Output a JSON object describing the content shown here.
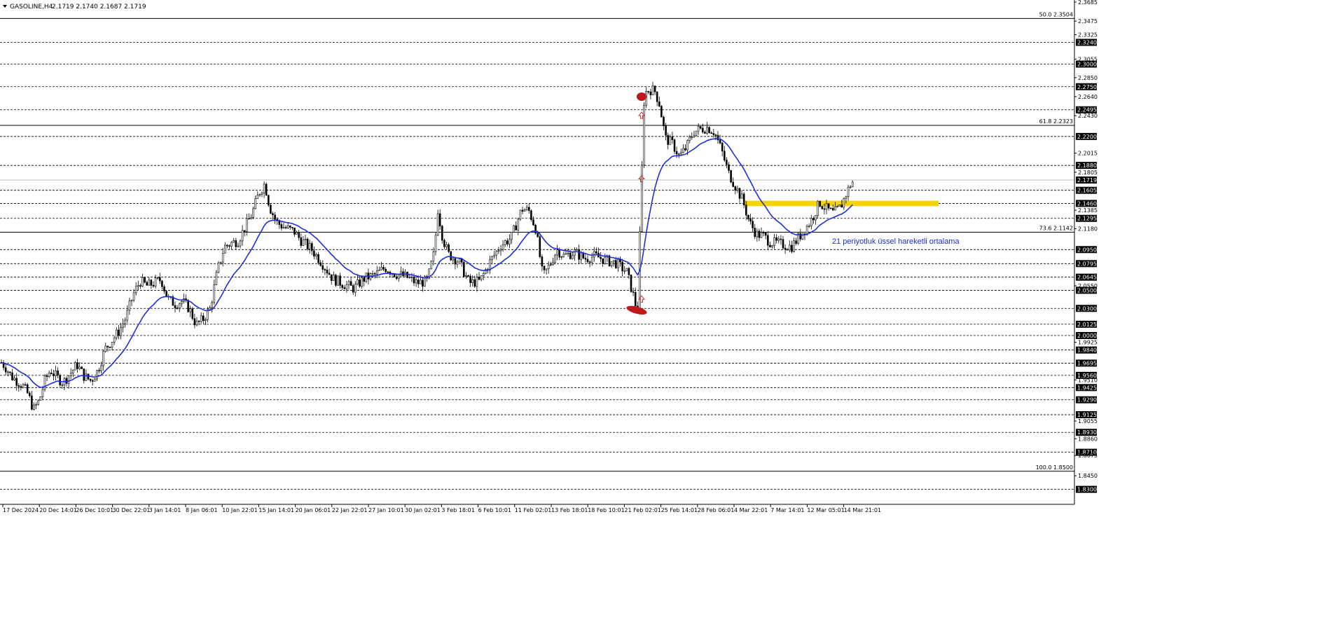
{
  "header": {
    "symbol": "GASOLINE,H4",
    "ohlc": "2.1719 2.1740 2.1687 2.1719"
  },
  "colors": {
    "background": "#ffffff",
    "candle": "#000000",
    "ema": "#1c2fe0",
    "zone": "#f5d400",
    "marker": "#c01818",
    "arrow": "#e03030",
    "grid": "#000000"
  },
  "chart_data": {
    "type": "candlestick",
    "title": "",
    "ylim": [
      1.815,
      2.3685
    ],
    "y_ticks": [
      "2.3685",
      "2.3475",
      "2.3325",
      "2.3240",
      "2.3055",
      "2.3000",
      "2.2850",
      "2.2750",
      "2.2640",
      "2.2495",
      "2.2430",
      "2.2200",
      "2.2015",
      "2.1880",
      "2.1805",
      "2.1719",
      "2.1605",
      "2.1460",
      "2.1385",
      "2.1295",
      "2.1180",
      "2.0950",
      "2.0795",
      "2.0645",
      "2.0550",
      "2.0500",
      "2.0300",
      "2.0125",
      "2.0000",
      "1.9925",
      "1.9840",
      "1.9695",
      "1.9560",
      "1.9510",
      "1.9425",
      "1.9290",
      "1.9125",
      "1.9055",
      "1.8930",
      "1.8860",
      "1.8710",
      "1.8675",
      "1.8450",
      "1.8300"
    ],
    "highlighted_y_ticks": [
      "2.3240",
      "2.3000",
      "2.2750",
      "2.2495",
      "2.2200",
      "2.1880",
      "2.1719",
      "2.1605",
      "2.1460",
      "2.1295",
      "2.0950",
      "2.0795",
      "2.0645",
      "2.0500",
      "2.0300",
      "2.0125",
      "2.0000",
      "1.9840",
      "1.9695",
      "1.9560",
      "1.9425",
      "1.9290",
      "1.9125",
      "1.8930",
      "1.8710",
      "1.8300"
    ],
    "x_ticks": [
      "17 Dec 2024",
      "20 Dec 14:01",
      "26 Dec 10:01",
      "30 Dec 22:01",
      "3 Jan 14:01",
      "8 Jan 06:01",
      "10 Jan 22:01",
      "15 Jan 14:01",
      "20 Jan 06:01",
      "22 Jan 22:01",
      "27 Jan 10:01",
      "30 Jan 02:01",
      "3 Feb 18:01",
      "6 Feb 10:01",
      "11 Feb 02:01",
      "13 Feb 18:01",
      "18 Feb 10:01",
      "21 Feb 02:01",
      "25 Feb 14:01",
      "28 Feb 06:01",
      "4 Mar 22:01",
      "7 Mar 14:01",
      "12 Mar 05:01",
      "14 Mar 21:01"
    ],
    "fib_levels": [
      {
        "label": "50.0 2.3504",
        "value": 2.3504
      },
      {
        "label": "61.8 2.2323",
        "value": 2.2323
      },
      {
        "label": "73.6 2.1142",
        "value": 2.1142
      },
      {
        "label": "100.0 1.8500",
        "value": 1.85
      }
    ],
    "current_price": 2.1719,
    "price_path": [
      [
        0,
        1.972
      ],
      [
        8,
        1.965
      ],
      [
        16,
        1.955
      ],
      [
        24,
        1.95
      ],
      [
        32,
        1.945
      ],
      [
        40,
        1.935
      ],
      [
        48,
        1.918
      ],
      [
        56,
        1.928
      ],
      [
        64,
        1.95
      ],
      [
        72,
        1.962
      ],
      [
        80,
        1.955
      ],
      [
        90,
        1.948
      ],
      [
        100,
        1.958
      ],
      [
        110,
        1.968
      ],
      [
        120,
        1.955
      ],
      [
        130,
        1.95
      ],
      [
        140,
        1.962
      ],
      [
        150,
        1.985
      ],
      [
        160,
        1.995
      ],
      [
        170,
        2.005
      ],
      [
        180,
        2.02
      ],
      [
        190,
        2.045
      ],
      [
        200,
        2.06
      ],
      [
        210,
        2.055
      ],
      [
        220,
        2.058
      ],
      [
        230,
        2.062
      ],
      [
        240,
        2.04
      ],
      [
        250,
        2.035
      ],
      [
        260,
        2.038
      ],
      [
        270,
        2.03
      ],
      [
        280,
        2.012
      ],
      [
        290,
        2.018
      ],
      [
        300,
        2.03
      ],
      [
        310,
        2.07
      ],
      [
        320,
        2.098
      ],
      [
        330,
        2.102
      ],
      [
        340,
        2.105
      ],
      [
        350,
        2.12
      ],
      [
        360,
        2.135
      ],
      [
        370,
        2.158
      ],
      [
        378,
        2.168
      ],
      [
        385,
        2.142
      ],
      [
        395,
        2.125
      ],
      [
        405,
        2.12
      ],
      [
        420,
        2.115
      ],
      [
        430,
        2.105
      ],
      [
        445,
        2.095
      ],
      [
        460,
        2.08
      ],
      [
        475,
        2.063
      ],
      [
        490,
        2.057
      ],
      [
        505,
        2.052
      ],
      [
        520,
        2.063
      ],
      [
        535,
        2.067
      ],
      [
        550,
        2.075
      ],
      [
        565,
        2.068
      ],
      [
        580,
        2.065
      ],
      [
        595,
        2.058
      ],
      [
        610,
        2.06
      ],
      [
        620,
        2.092
      ],
      [
        625,
        2.14
      ],
      [
        632,
        2.108
      ],
      [
        640,
        2.09
      ],
      [
        655,
        2.082
      ],
      [
        670,
        2.058
      ],
      [
        685,
        2.06
      ],
      [
        700,
        2.082
      ],
      [
        715,
        2.1
      ],
      [
        730,
        2.108
      ],
      [
        745,
        2.14
      ],
      [
        755,
        2.138
      ],
      [
        765,
        2.118
      ],
      [
        775,
        2.065
      ],
      [
        785,
        2.078
      ],
      [
        795,
        2.095
      ],
      [
        805,
        2.088
      ],
      [
        820,
        2.092
      ],
      [
        835,
        2.085
      ],
      [
        850,
        2.088
      ],
      [
        865,
        2.083
      ],
      [
        880,
        2.08
      ],
      [
        895,
        2.07
      ],
      [
        905,
        2.042
      ],
      [
        910,
        2.025
      ],
      [
        915,
        2.15
      ],
      [
        920,
        2.268
      ],
      [
        928,
        2.272
      ],
      [
        935,
        2.27
      ],
      [
        942,
        2.255
      ],
      [
        950,
        2.218
      ],
      [
        960,
        2.212
      ],
      [
        970,
        2.198
      ],
      [
        980,
        2.208
      ],
      [
        990,
        2.225
      ],
      [
        1000,
        2.228
      ],
      [
        1010,
        2.23
      ],
      [
        1020,
        2.225
      ],
      [
        1030,
        2.205
      ],
      [
        1040,
        2.18
      ],
      [
        1050,
        2.165
      ],
      [
        1060,
        2.15
      ],
      [
        1070,
        2.125
      ],
      [
        1080,
        2.112
      ],
      [
        1090,
        2.11
      ],
      [
        1100,
        2.103
      ],
      [
        1110,
        2.102
      ],
      [
        1120,
        2.1
      ],
      [
        1130,
        2.098
      ],
      [
        1140,
        2.108
      ],
      [
        1150,
        2.118
      ],
      [
        1160,
        2.13
      ],
      [
        1170,
        2.147
      ],
      [
        1180,
        2.14
      ],
      [
        1190,
        2.135
      ],
      [
        1200,
        2.142
      ],
      [
        1210,
        2.16
      ],
      [
        1215,
        2.168
      ],
      [
        1220,
        2.172
      ]
    ]
  },
  "annotations": {
    "ema_label": "21 periyotluk üssel hareketli ortalama"
  }
}
